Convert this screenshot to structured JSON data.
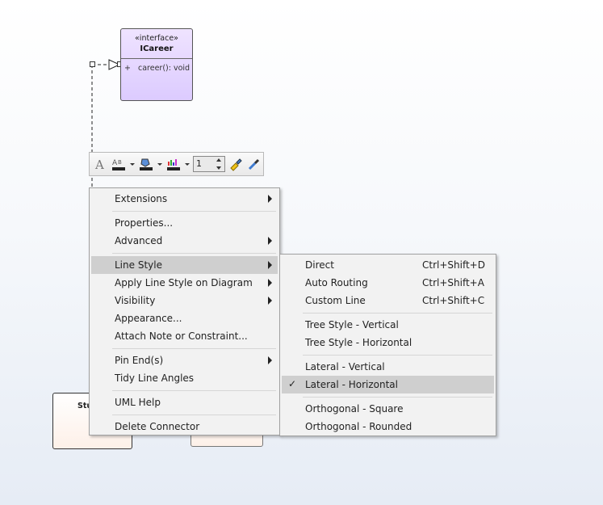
{
  "diagram": {
    "interface_box": {
      "stereotype": "«interface»",
      "name": "ICareer",
      "visibility": "+",
      "operation": "career(): void"
    },
    "class_box_label": "Stu"
  },
  "toolbar": {
    "icons": [
      "font-icon",
      "text-color-icon",
      "fill-color-icon",
      "line-color-icon",
      "format-painter-icon",
      "eyedropper-icon"
    ],
    "line_width": "1"
  },
  "context_menu": {
    "items": [
      {
        "label": "Extensions",
        "submenu": true
      },
      {
        "label": "Properties...",
        "submenu": false
      },
      {
        "label": "Advanced",
        "submenu": true
      },
      {
        "label": "Line Style",
        "submenu": true,
        "highlighted": true
      },
      {
        "label": "Apply Line Style on Diagram",
        "submenu": true
      },
      {
        "label": "Visibility",
        "submenu": true
      },
      {
        "label": "Appearance...",
        "submenu": false
      },
      {
        "label": "Attach Note or Constraint...",
        "submenu": false
      },
      {
        "label": "Pin End(s)",
        "submenu": true
      },
      {
        "label": "Tidy Line Angles",
        "submenu": false
      },
      {
        "label": "UML Help",
        "submenu": false
      },
      {
        "label": "Delete Connector",
        "submenu": false
      }
    ]
  },
  "line_style_submenu": {
    "items": [
      {
        "label": "Direct",
        "shortcut": "Ctrl+Shift+D"
      },
      {
        "label": "Auto Routing",
        "shortcut": "Ctrl+Shift+A"
      },
      {
        "label": "Custom Line",
        "shortcut": "Ctrl+Shift+C"
      },
      {
        "label": "Tree Style - Vertical",
        "shortcut": ""
      },
      {
        "label": "Tree Style - Horizontal",
        "shortcut": ""
      },
      {
        "label": "Lateral - Vertical",
        "shortcut": ""
      },
      {
        "label": "Lateral - Horizontal",
        "shortcut": "",
        "checked": true,
        "highlighted": true
      },
      {
        "label": "Orthogonal - Square",
        "shortcut": ""
      },
      {
        "label": "Orthogonal - Rounded",
        "shortcut": ""
      }
    ],
    "check_mark": "✓"
  },
  "colors": {
    "interface_fill": "#dccbff",
    "menu_background": "#f2f2f2",
    "menu_highlight": "#cfcfcf"
  }
}
